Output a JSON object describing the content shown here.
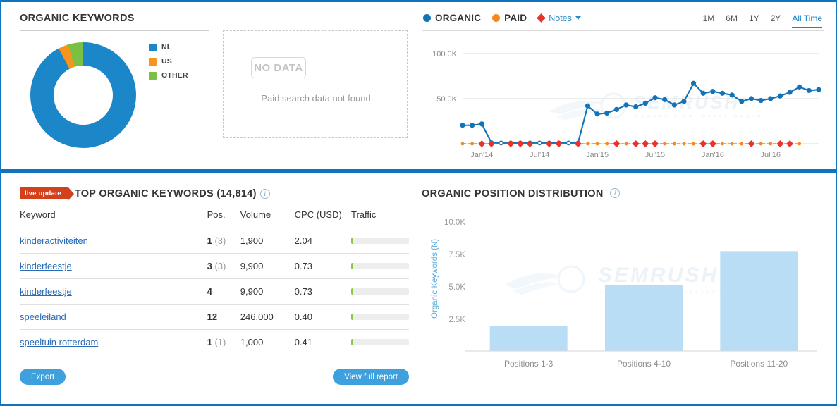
{
  "colors": {
    "brand_blue": "#0d74bd",
    "organic_blue": "#1273b8",
    "paid_orange": "#f5881f",
    "notes_red": "#e8332a",
    "nl_blue": "#1b87c9",
    "us_orange": "#f7941e",
    "other_green": "#7ac143",
    "bar_blue": "#b9ddf5",
    "link_blue": "#2a6bb5",
    "badge_red": "#d1421c",
    "button_blue": "#3ea0dc"
  },
  "organic_keywords_panel": {
    "title": "ORGANIC KEYWORDS",
    "legend": [
      {
        "label": "NL",
        "color": "#1b87c9",
        "percent": 94
      },
      {
        "label": "US",
        "color": "#f7941e",
        "percent": 3
      },
      {
        "label": "OTHER",
        "color": "#7ac143",
        "percent": 3
      }
    ]
  },
  "paid_panel": {
    "badge": "NO DATA",
    "message": "Paid search data not found"
  },
  "trend_panel": {
    "legend": [
      {
        "label": "ORGANIC",
        "marker": "circle",
        "color": "#1273b8"
      },
      {
        "label": "PAID",
        "marker": "circle",
        "color": "#f5881f"
      },
      {
        "label": "Notes",
        "marker": "diamond",
        "color": "#e8332a",
        "has_caret": true
      }
    ],
    "range_tabs": [
      {
        "label": "1M",
        "active": false
      },
      {
        "label": "6M",
        "active": false
      },
      {
        "label": "1Y",
        "active": false
      },
      {
        "label": "2Y",
        "active": false
      },
      {
        "label": "All Time",
        "active": true
      }
    ]
  },
  "keywords_panel": {
    "live_badge": "live update",
    "title": "TOP ORGANIC KEYWORDS (14,814)",
    "columns": [
      "Keyword",
      "Pos.",
      "Volume",
      "CPC (USD)",
      "Traffic"
    ],
    "rows": [
      {
        "keyword": "kinderactiviteiten",
        "pos": "1",
        "pos_prev": "(3)",
        "volume": "1,900",
        "cpc": "2.04",
        "traffic_pct": 4
      },
      {
        "keyword": "kinderfeestje",
        "pos": "3",
        "pos_prev": "(3)",
        "volume": "9,900",
        "cpc": "0.73",
        "traffic_pct": 4
      },
      {
        "keyword": "kinderfeestje",
        "pos": "4",
        "pos_prev": "",
        "volume": "9,900",
        "cpc": "0.73",
        "traffic_pct": 4
      },
      {
        "keyword": "speeleiland",
        "pos": "12",
        "pos_prev": "",
        "volume": "246,000",
        "cpc": "0.40",
        "traffic_pct": 4
      },
      {
        "keyword": "speeltuin rotterdam",
        "pos": "1",
        "pos_prev": "(1)",
        "volume": "1,000",
        "cpc": "0.41",
        "traffic_pct": 4
      }
    ],
    "export_label": "Export",
    "view_report_label": "View full report"
  },
  "position_distribution_panel": {
    "title": "ORGANIC POSITION DISTRIBUTION"
  },
  "watermark": {
    "text": "SEMRUSH",
    "subtext": "COMPETITIVE INTELLIGENCE"
  },
  "chart_data": [
    {
      "type": "line",
      "title": "Organic / Paid keywords over time",
      "xlabel": "",
      "ylabel": "",
      "ylim": [
        0,
        100000
      ],
      "yticks": [
        50000,
        100000
      ],
      "ytick_labels": [
        "50.0K",
        "100.0K"
      ],
      "xtick_labels": [
        "Jan'14",
        "Jul'14",
        "Jan'15",
        "Jul'15",
        "Jan'16",
        "Jul'16"
      ],
      "xtick_index": [
        2,
        8,
        14,
        20,
        26,
        32
      ],
      "grid": true,
      "legend_position": "top-left",
      "x": [
        "Nov'13",
        "Dec'13",
        "Jan'14",
        "Feb'14",
        "Mar'14",
        "Apr'14",
        "May'14",
        "Jun'14",
        "Jul'14",
        "Aug'14",
        "Sep'14",
        "Oct'14",
        "Nov'14",
        "Dec'14",
        "Jan'15",
        "Feb'15",
        "Mar'15",
        "Apr'15",
        "May'15",
        "Jun'15",
        "Jul'15",
        "Aug'15",
        "Sep'15",
        "Oct'15",
        "Nov'15",
        "Dec'15",
        "Jan'16",
        "Feb'16",
        "Mar'16",
        "Apr'16",
        "May'16",
        "Jun'16",
        "Jul'16",
        "Aug'16",
        "Sep'16",
        "Oct'16"
      ],
      "series": [
        {
          "name": "ORGANIC",
          "color": "#1273b8",
          "values": [
            20500,
            20500,
            22000,
            1200,
            900,
            900,
            900,
            900,
            900,
            900,
            900,
            900,
            900,
            42000,
            33000,
            34000,
            38000,
            43000,
            41000,
            45000,
            51000,
            49000,
            43000,
            47000,
            67000,
            56000,
            58000,
            56000,
            54000,
            47000,
            50000,
            48000,
            50000,
            53000,
            57000,
            63000,
            59000,
            60000
          ]
        },
        {
          "name": "PAID",
          "color": "#f5881f",
          "values": [
            0,
            0,
            0,
            0,
            0,
            0,
            0,
            0,
            0,
            0,
            0,
            0,
            0,
            0,
            0,
            0,
            0,
            0,
            0,
            0,
            0,
            0,
            0,
            0,
            0,
            0,
            0,
            0,
            0,
            0,
            0,
            0,
            0,
            0,
            0,
            0
          ]
        }
      ],
      "notes_markers_color": "#e8332a"
    },
    {
      "type": "bar",
      "title": "ORGANIC POSITION DISTRIBUTION",
      "categories": [
        "Positions 1-3",
        "Positions 4-10",
        "Positions 11-20"
      ],
      "values": [
        1900,
        5100,
        7700
      ],
      "xlabel": "",
      "ylabel": "Organic Keywords (N)",
      "ylim": [
        0,
        10000
      ],
      "yticks": [
        2500,
        5000,
        7500,
        10000
      ],
      "ytick_labels": [
        "2.5K",
        "5.0K",
        "7.5K",
        "10.0K"
      ],
      "grid": false,
      "bar_color": "#b9ddf5"
    },
    {
      "type": "pie",
      "title": "ORGANIC KEYWORDS",
      "labels": [
        "NL",
        "US",
        "OTHER"
      ],
      "values": [
        94,
        3,
        3
      ],
      "colors": [
        "#1b87c9",
        "#f7941e",
        "#7ac143"
      ],
      "donut": true,
      "legend_position": "right"
    }
  ]
}
